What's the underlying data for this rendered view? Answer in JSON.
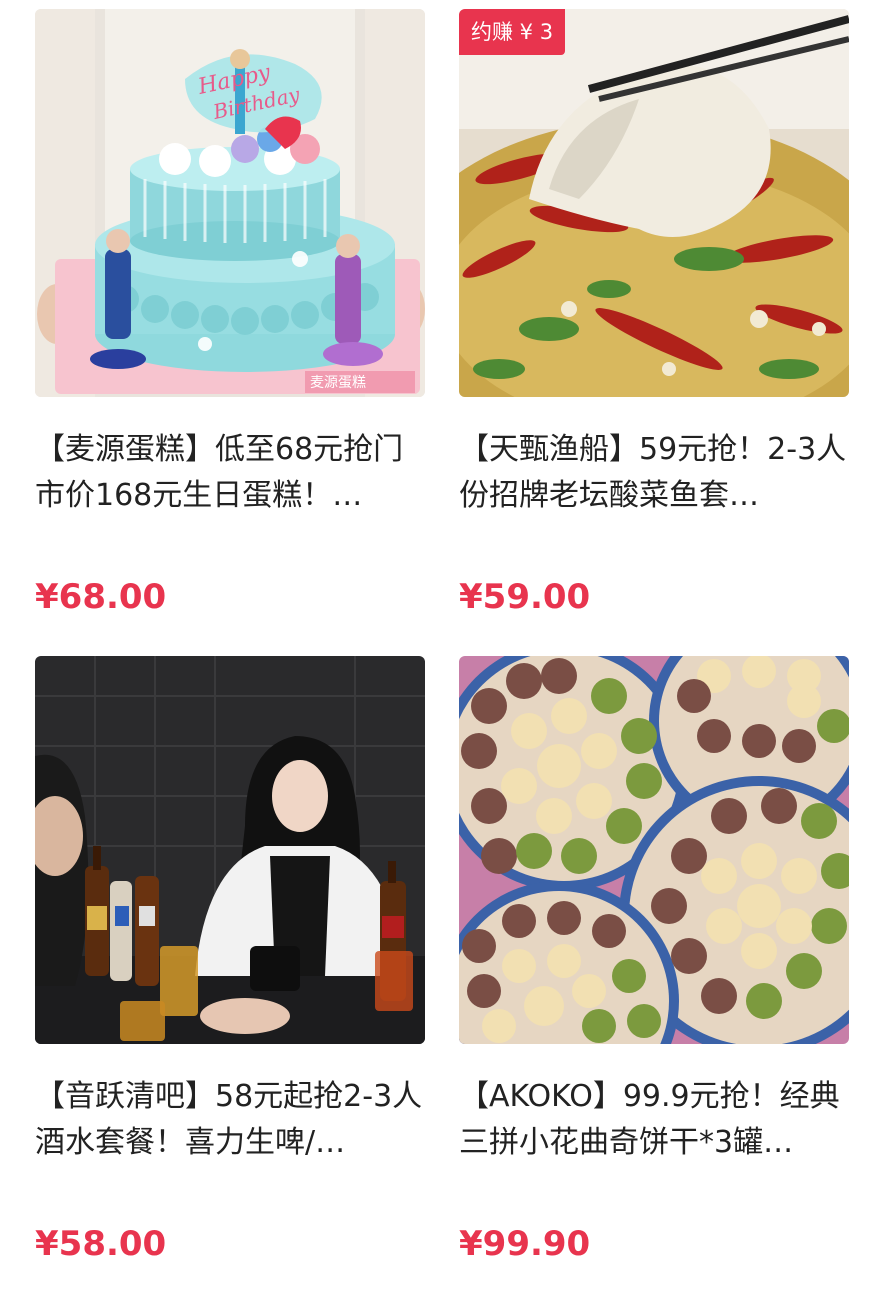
{
  "colors": {
    "price": "#e8344e",
    "badge_bg": "#e8344e",
    "title": "#222222"
  },
  "products": [
    {
      "title": "【麦源蛋糕】低至68元抢门市价168元生日蛋糕！…",
      "price": "¥68.00",
      "badge": "",
      "image": "birthday-cake-photo",
      "image_text": "Happy Birthday / 麦源蛋糕"
    },
    {
      "title": "【天甄渔船】59元抢！2-3人份招牌老坛酸菜鱼套…",
      "price": "¥59.00",
      "badge": "约赚 ¥ 3",
      "image": "pickled-fish-soup-photo"
    },
    {
      "title": "【音跃清吧】58元起抢2-3人酒水套餐！喜力生啤/…",
      "price": "¥58.00",
      "badge": "",
      "image": "bar-drinks-photo"
    },
    {
      "title": "【AKOKO】99.9元抢！经典三拼小花曲奇饼干*3罐…",
      "price": "¥99.90",
      "badge": "",
      "image": "cookie-tins-photo"
    }
  ]
}
